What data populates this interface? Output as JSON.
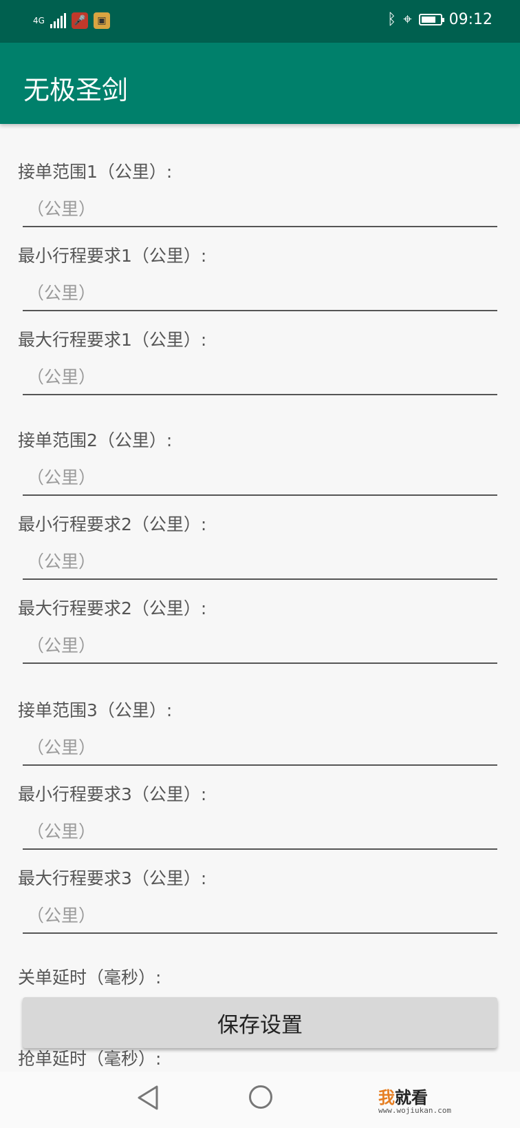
{
  "status_bar": {
    "network": "4G",
    "time": "09:12",
    "battery_level": 0.8
  },
  "app": {
    "title": "无极圣剑"
  },
  "form": {
    "fields": [
      {
        "label": "接单范围1（公里）:",
        "placeholder": "（公里）"
      },
      {
        "label": "最小行程要求1（公里）:",
        "placeholder": "（公里）"
      },
      {
        "label": "最大行程要求1（公里）:",
        "placeholder": "（公里）"
      },
      {
        "label": "接单范围2（公里）:",
        "placeholder": "（公里）"
      },
      {
        "label": "最小行程要求2（公里）:",
        "placeholder": "（公里）"
      },
      {
        "label": "最大行程要求2（公里）:",
        "placeholder": "（公里）"
      },
      {
        "label": "接单范围3（公里）:",
        "placeholder": "（公里）"
      },
      {
        "label": "最小行程要求3（公里）:",
        "placeholder": "（公里）"
      },
      {
        "label": "最大行程要求3（公里）:",
        "placeholder": "（公里）"
      }
    ],
    "close_delay_label": "关单延时（毫秒）:",
    "grab_delay_label": "抢单延时（毫秒）:",
    "save_label": "保存设置"
  },
  "watermark": {
    "brand_highlight": "我",
    "brand_rest": "就看",
    "url": "www.wojiukan.com"
  }
}
